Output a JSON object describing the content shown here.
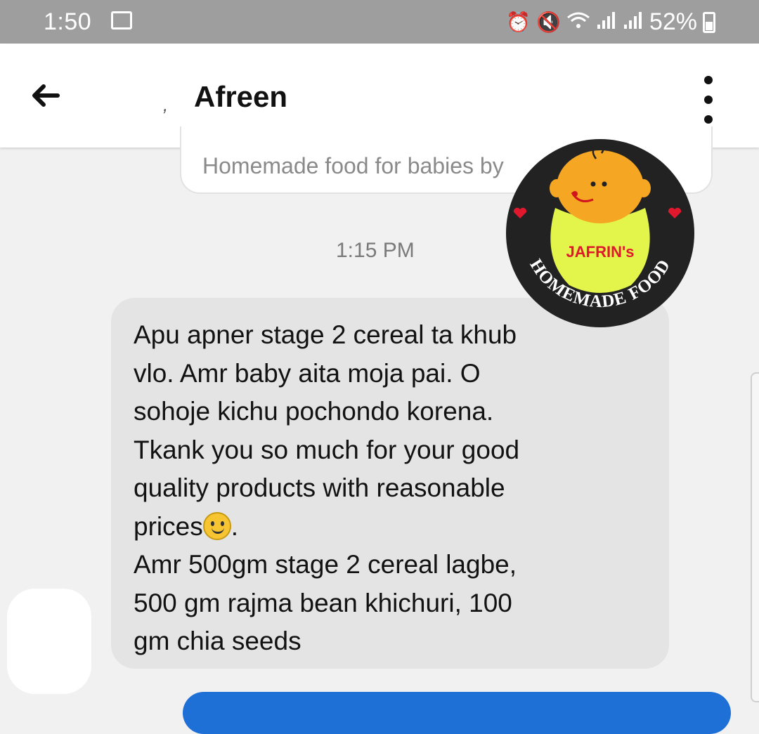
{
  "status_bar": {
    "time": "1:50",
    "battery": "52%",
    "icons": [
      "gallery-icon",
      "alarm-icon",
      "mute-icon",
      "wifi-icon",
      "signal-icon",
      "signal-icon",
      "battery-icon"
    ]
  },
  "header": {
    "title": "Afreen",
    "back_icon": "arrow-left-icon",
    "menu_icon": "more-vertical-icon"
  },
  "chat": {
    "previous_message_preview": "Homemade food for babies by",
    "timestamp": "1:15 PM",
    "message_text": "Apu apner stage 2 cereal ta khub\nvlo. Amr baby aita moja pai. O\nsohoje kichu pochondo korena.\nTkank you so much for your good\nquality products with reasonable\nprices",
    "message_text_2": ".\nAmr 500gm stage 2 cereal lagbe,\n500 gm rajma bean khichuri, 100\ngm chia seeds",
    "emoji": "slightly-smiling-face"
  },
  "logo": {
    "brand": "JAFRIN's",
    "arc_text": "HOMEMADE FOOD"
  },
  "colors": {
    "status_bar": "#9e9e9e",
    "header_bg": "#ffffff",
    "chat_bg": "#f1f1f1",
    "incoming_bubble": "#e4e4e4",
    "outgoing_bubble": "#1e6fd6",
    "logo_bg": "#222222",
    "logo_face": "#f5a623",
    "logo_bib": "#e3f54a",
    "logo_brand_text": "#e0182d"
  }
}
